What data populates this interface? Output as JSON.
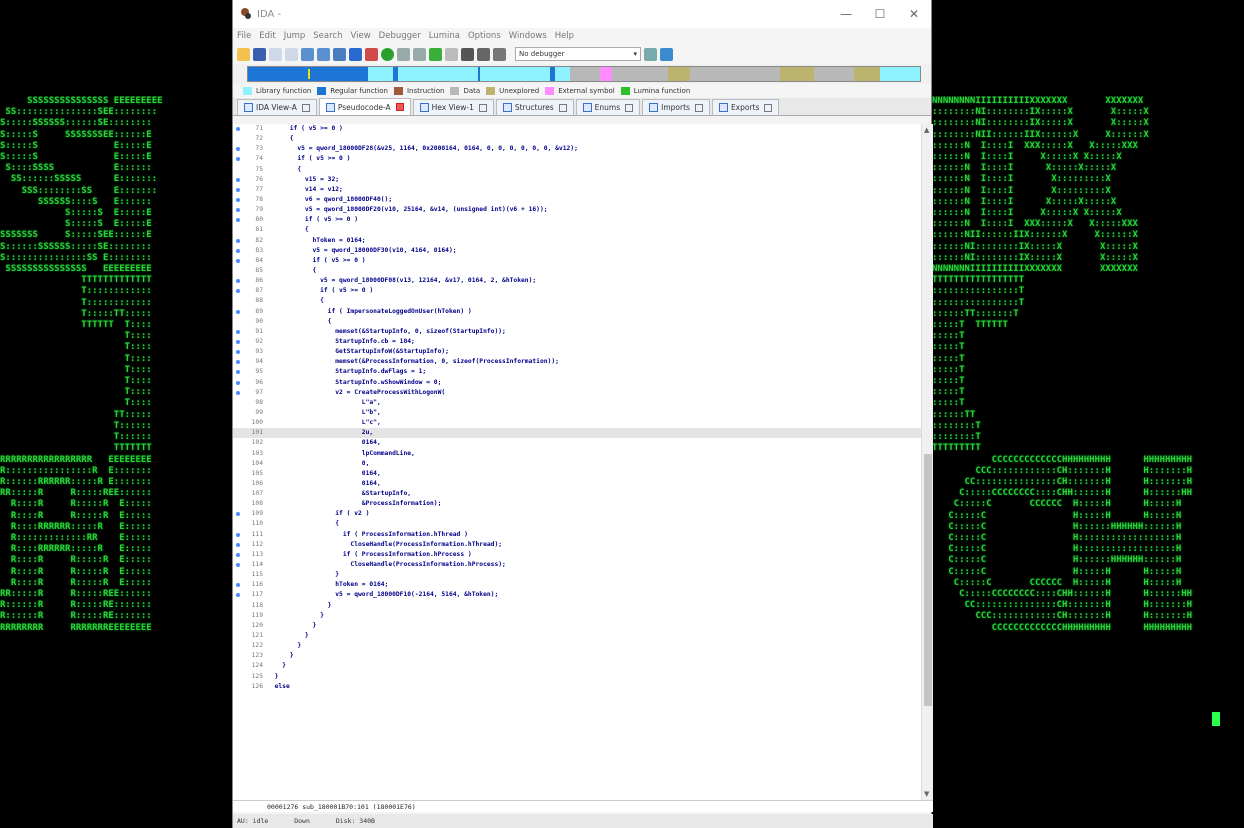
{
  "window": {
    "title": "IDA -",
    "controls": [
      "—",
      "☐",
      "✕"
    ]
  },
  "menu": [
    "File",
    "Edit",
    "Jump",
    "Search",
    "View",
    "Debugger",
    "Lumina",
    "Options",
    "Windows",
    "Help"
  ],
  "toolbar": {
    "debugger": "No debugger"
  },
  "legend": [
    {
      "label": "Library function",
      "color": "#8ff3ff"
    },
    {
      "label": "Regular function",
      "color": "#1d75d6"
    },
    {
      "label": "Instruction",
      "color": "#a05a3a"
    },
    {
      "label": "Data",
      "color": "#b8b8b8"
    },
    {
      "label": "Unexplored",
      "color": "#bcb46e"
    },
    {
      "label": "External symbol",
      "color": "#ff8cff"
    },
    {
      "label": "Lumina function",
      "color": "#2cc02c"
    }
  ],
  "tabs": [
    {
      "label": "IDA View-A",
      "active": false
    },
    {
      "label": "Pseudocode-A",
      "active": true
    },
    {
      "label": "Hex View-1",
      "active": false
    },
    {
      "label": "Structures",
      "active": false
    },
    {
      "label": "Enums",
      "active": false
    },
    {
      "label": "Imports",
      "active": false
    },
    {
      "label": "Exports",
      "active": false
    }
  ],
  "code": [
    {
      "n": "71",
      "t": "      if ( v5 >= 0 )",
      "dot": true
    },
    {
      "n": "72",
      "t": "      {",
      "dot": false
    },
    {
      "n": "73",
      "t": "        v5 = qword_18000DF28(&v25, 1164, 0x2000164, 0164, 0, 0, 0, 0, 0, 0, &v12);",
      "dot": true
    },
    {
      "n": "74",
      "t": "        if ( v5 >= 0 )",
      "dot": true
    },
    {
      "n": "75",
      "t": "        {",
      "dot": false
    },
    {
      "n": "76",
      "t": "          v15 = 32;",
      "dot": true
    },
    {
      "n": "77",
      "t": "          v14 = v12;",
      "dot": true
    },
    {
      "n": "78",
      "t": "          v6 = qword_18000DF40();",
      "dot": true
    },
    {
      "n": "79",
      "t": "          v5 = qword_18000DF20(v10, 25164, &v14, (unsigned int)(v6 + 16));",
      "dot": true
    },
    {
      "n": "80",
      "t": "          if ( v5 >= 0 )",
      "dot": true
    },
    {
      "n": "81",
      "t": "          {",
      "dot": false
    },
    {
      "n": "82",
      "t": "            hToken = 0164;",
      "dot": true
    },
    {
      "n": "83",
      "t": "            v5 = qword_18000DF30(v10, 4164, 0164);",
      "dot": true
    },
    {
      "n": "84",
      "t": "            if ( v5 >= 0 )",
      "dot": true
    },
    {
      "n": "85",
      "t": "            {",
      "dot": false
    },
    {
      "n": "86",
      "t": "              v5 = qword_18000DF08(v13, 12164, &v17, 0164, 2, &hToken);",
      "dot": true
    },
    {
      "n": "87",
      "t": "              if ( v5 >= 0 )",
      "dot": true
    },
    {
      "n": "88",
      "t": "              {",
      "dot": false
    },
    {
      "n": "89",
      "t": "                if ( ImpersonateLoggedOnUser(hToken) )",
      "dot": true
    },
    {
      "n": "90",
      "t": "                {",
      "dot": false
    },
    {
      "n": "91",
      "t": "                  memset(&StartupInfo, 0, sizeof(StartupInfo));",
      "dot": true
    },
    {
      "n": "92",
      "t": "                  StartupInfo.cb = 104;",
      "dot": true
    },
    {
      "n": "93",
      "t": "                  GetStartupInfoW(&StartupInfo);",
      "dot": true
    },
    {
      "n": "94",
      "t": "                  memset(&ProcessInformation, 0, sizeof(ProcessInformation));",
      "dot": true
    },
    {
      "n": "95",
      "t": "                  StartupInfo.dwFlags = 1;",
      "dot": true
    },
    {
      "n": "96",
      "t": "                  StartupInfo.wShowWindow = 0;",
      "dot": true
    },
    {
      "n": "97",
      "t": "                  v2 = CreateProcessWithLogonW(",
      "dot": true
    },
    {
      "n": "98",
      "t": "                         L\"a\",",
      "dot": false
    },
    {
      "n": "99",
      "t": "                         L\"b\",",
      "dot": false
    },
    {
      "n": "100",
      "t": "                         L\"c\",",
      "dot": false
    },
    {
      "n": "101",
      "t": "                         2u,",
      "dot": false,
      "hl": true
    },
    {
      "n": "102",
      "t": "                         0164,",
      "dot": false
    },
    {
      "n": "103",
      "t": "                         lpCommandLine,",
      "dot": false
    },
    {
      "n": "104",
      "t": "                         0,",
      "dot": false
    },
    {
      "n": "105",
      "t": "                         0164,",
      "dot": false
    },
    {
      "n": "106",
      "t": "                         0164,",
      "dot": false
    },
    {
      "n": "107",
      "t": "                         &StartupInfo,",
      "dot": false
    },
    {
      "n": "108",
      "t": "                         &ProcessInformation);",
      "dot": false
    },
    {
      "n": "109",
      "t": "                  if ( v2 )",
      "dot": true
    },
    {
      "n": "110",
      "t": "                  {",
      "dot": false
    },
    {
      "n": "111",
      "t": "                    if ( ProcessInformation.hThread )",
      "dot": true
    },
    {
      "n": "112",
      "t": "                      CloseHandle(ProcessInformation.hThread);",
      "dot": true
    },
    {
      "n": "113",
      "t": "                    if ( ProcessInformation.hProcess )",
      "dot": true
    },
    {
      "n": "114",
      "t": "                      CloseHandle(ProcessInformation.hProcess);",
      "dot": true
    },
    {
      "n": "115",
      "t": "                  }",
      "dot": false
    },
    {
      "n": "116",
      "t": "                  hToken = 0164;",
      "dot": true
    },
    {
      "n": "117",
      "t": "                  v5 = qword_18000DF10(-2164, 5164, &hToken);",
      "dot": true
    },
    {
      "n": "118",
      "t": "                }",
      "dot": false
    },
    {
      "n": "119",
      "t": "              }",
      "dot": false
    },
    {
      "n": "120",
      "t": "            }",
      "dot": false
    },
    {
      "n": "121",
      "t": "          }",
      "dot": false
    },
    {
      "n": "122",
      "t": "        }",
      "dot": false
    },
    {
      "n": "123",
      "t": "      }",
      "dot": false
    },
    {
      "n": "124",
      "t": "    }",
      "dot": false
    },
    {
      "n": "125",
      "t": "  }",
      "dot": false
    },
    {
      "n": "126",
      "t": "  else",
      "dot": false
    }
  ],
  "statusline": "00001276 sub_180001B70:101 (180001E76)",
  "appstatus": [
    "AU:  idle",
    "Down",
    "Disk: 340B"
  ],
  "ascii_left": "     SSSSSSSSSSSSSSS EEEEEEEEE\n SS:::::::::::::::SEE::::::::\nS:::::SSSSSS::::::SE::::::::\nS:::::S     SSSSSSSEE::::::E\nS:::::S              E:::::E\nS:::::S              E:::::E\n S::::SSSS           E::::::\n  SS::::::SSSSS      E:::::::\n    SSS::::::::SS    E:::::::\n       SSSSSS::::S   E::::::\n            S:::::S  E:::::E\n            S:::::S  E:::::E\nSSSSSSS     S:::::SEE::::::E\nS::::::SSSSSS:::::SE::::::::\nS:::::::::::::::SS E::::::::\n SSSSSSSSSSSSSSS   EEEEEEEEE\n               TTTTTTTTTTTTT\n               T::::::::::::\n               T::::::::::::\n               T:::::TT:::::\n               TTTTTT  T::::\n                       T::::\n                       T::::\n                       T::::\n                       T::::\n                       T::::\n                       T::::\n                       T::::\n                     TT:::::\n                     T::::::\n                     T::::::\n                     TTTTTTT\nRRRRRRRRRRRRRRRRR   EEEEEEEE\nR::::::::::::::::R  E:::::::\nR::::::RRRRRR:::::R E:::::::\nRR:::::R     R:::::REE::::::\n  R::::R     R:::::R  E:::::\n  R::::R     R:::::R  E:::::\n  R::::RRRRRR:::::R   E:::::\n  R:::::::::::::RR    E:::::\n  R::::RRRRRR:::::R   E:::::\n  R::::R     R:::::R  E:::::\n  R::::R     R:::::R  E:::::\n  R::::R     R:::::R  E:::::\nRR:::::R     R:::::REE::::::\nR::::::R     R:::::RE:::::::\nR::::::R     R:::::RE:::::::\nRRRRRRRR     RRRRRRREEEEEEEE",
  "ascii_right": "NNNNNNNNIIIIIIIIIIXXXXXXX       XXXXXXX\n::::::::NI::::::::IX:::::X       X:::::X\n::::::::NI::::::::IX:::::X       X:::::X\n::::::::NII::::::IIX::::::X     X::::::X\n::::::N  I::::I  XXX:::::X   X:::::XXX\n::::::N  I::::I     X:::::X X:::::X\n::::::N  I::::I      X:::::X:::::X\n::::::N  I::::I       X:::::::::X\n::::::N  I::::I       X:::::::::X\n::::::N  I::::I      X:::::X:::::X\n::::::N  I::::I     X:::::X X:::::X\n::::::N  I::::I  XXX:::::X   X:::::XXX\n::::::NII::::::IIX::::::X     X::::::X\n::::::NI::::::::IX:::::X       X:::::X\n::::::NI::::::::IX:::::X       X:::::X\nNNNNNNNIIIIIIIIIIXXXXXXX       XXXXXXX\nTTTTTTTTTTTTTTTTT\n::::::::::::::::T\n::::::::::::::::T\n::::::TT:::::::T\n:::::T  TTTTTT\n:::::T\n:::::T\n:::::T\n:::::T\n:::::T\n:::::T\n:::::T\n::::::TT\n::::::::T\n::::::::T\nTTTTTTTTT\n           CCCCCCCCCCCCCHHHHHHHHH      HHHHHHHHH\n        CCC::::::::::::CH:::::::H      H:::::::H\n      CC:::::::::::::::CH:::::::H      H:::::::H\n     C:::::CCCCCCCC::::CHH::::::H      H::::::HH\n    C:::::C       CCCCCC  H:::::H      H:::::H\n   C:::::C                H:::::H      H:::::H\n   C:::::C                H::::::HHHHHH::::::H\n   C:::::C                H::::::::::::::::::H\n   C:::::C                H::::::::::::::::::H\n   C:::::C                H::::::HHHHHH::::::H\n   C:::::C                H:::::H      H:::::H\n    C:::::C       CCCCCC  H:::::H      H:::::H\n     C:::::CCCCCCCC::::CHH::::::H      H::::::HH\n      CC:::::::::::::::CH:::::::H      H:::::::H\n        CCC::::::::::::CH:::::::H      H:::::::H\n           CCCCCCCCCCCCCHHHHHHHHH      HHHHHHHHH"
}
